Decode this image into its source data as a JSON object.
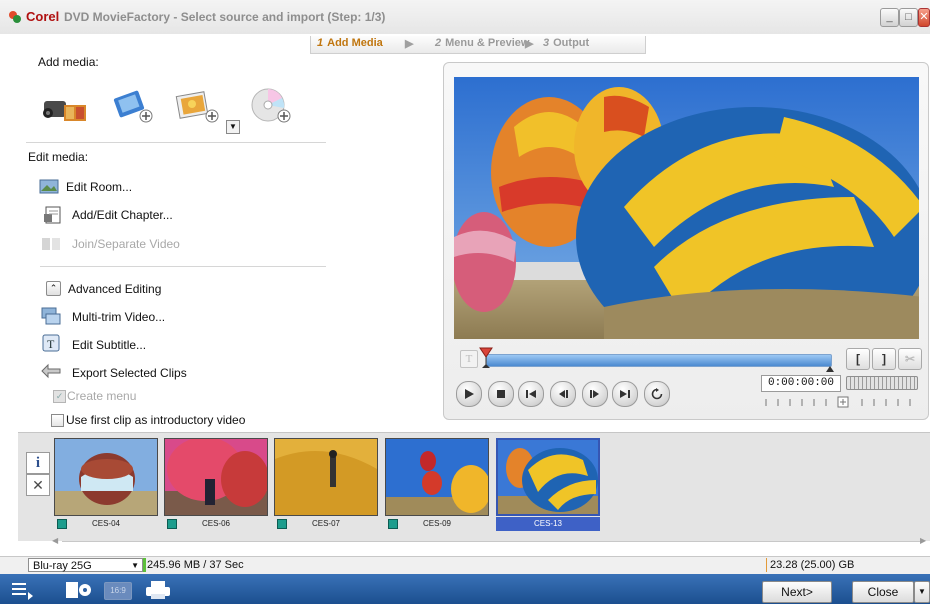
{
  "window": {
    "title_brand": "Corel",
    "title_text": "DVD MovieFactory - Select source and import (Step: 1/3)",
    "min_symbol": "_",
    "max_symbol": "□",
    "close_symbol": "✕"
  },
  "steps": [
    {
      "num": "1",
      "label": "Add Media",
      "active": true
    },
    {
      "num": "2",
      "label": "Menu & Preview",
      "active": false
    },
    {
      "num": "3",
      "label": "Output",
      "active": false
    }
  ],
  "left_panel": {
    "add_media_label": "Add media:",
    "edit_media_label": "Edit media:",
    "add_media_icons": [
      "video-capture-icon",
      "add-video-icon",
      "add-photo-icon",
      "add-disc-icon"
    ],
    "edit_items": [
      {
        "label": "Edit Room...",
        "enabled": true,
        "icon": "edit-room-icon"
      },
      {
        "label": "Add/Edit Chapter...",
        "enabled": true,
        "icon": "chapter-icon"
      },
      {
        "label": "Join/Separate Video",
        "enabled": false,
        "icon": "join-video-icon"
      }
    ],
    "advanced_label": "Advanced Editing",
    "advanced_items": [
      {
        "label": "Multi-trim Video...",
        "icon": "multi-trim-icon"
      },
      {
        "label": "Edit Subtitle...",
        "icon": "subtitle-icon"
      },
      {
        "label": "Export Selected Clips",
        "icon": "export-clips-icon"
      }
    ],
    "create_menu_label": "Create menu",
    "intro_video_label": "Use first clip as introductory video"
  },
  "player": {
    "timecode": "0:00:00:00",
    "subtitle_btn": "T",
    "mark_in": "[",
    "mark_out": "]",
    "cut": "✂"
  },
  "clips": [
    {
      "label": "CES-04",
      "selected": false
    },
    {
      "label": "CES-06",
      "selected": false
    },
    {
      "label": "CES-07",
      "selected": false
    },
    {
      "label": "CES-09",
      "selected": false
    },
    {
      "label": "CES-13",
      "selected": true
    }
  ],
  "side_tools": {
    "info": "i",
    "remove": "✕"
  },
  "status": {
    "disc_type": "Blu-ray 25G",
    "usage": "245.96 MB / 37 Sec",
    "capacity": "23.28 (25.00) GB"
  },
  "bottom": {
    "next_label": "Next>",
    "close_label": "Close"
  }
}
